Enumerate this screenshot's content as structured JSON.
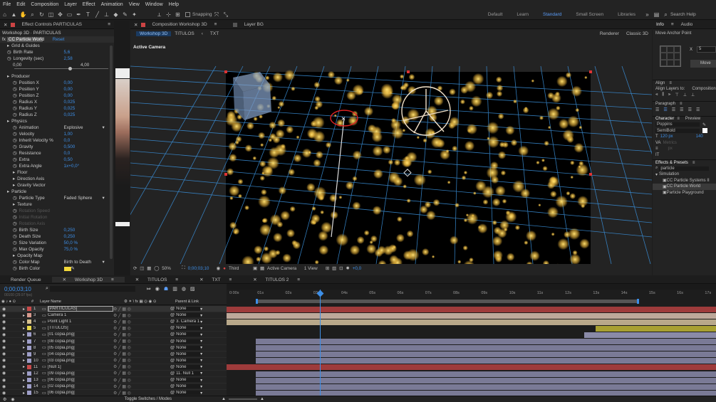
{
  "menu": [
    "File",
    "Edit",
    "Composition",
    "Layer",
    "Effect",
    "Animation",
    "View",
    "Window",
    "Help"
  ],
  "toolbar": {
    "snapping": "Snapping",
    "search": "Search Help",
    "workspaces": [
      "Default",
      "Learn",
      "Standard",
      "Small Screen",
      "Libraries"
    ]
  },
  "effects": {
    "tab": "Effect Controls",
    "tab_target": "PARTICULAS",
    "breadcrumb": "Workshop 3D · PARTICULAS",
    "effect_name": "CC Particle World",
    "reset": "Reset",
    "rows": [
      {
        "label": "Grid & Guides",
        "value": "",
        "indent": 1,
        "kind": "group"
      },
      {
        "label": "Birth Rate",
        "value": "5,6",
        "indent": 1,
        "kind": "param"
      },
      {
        "label": "Longevity (sec)",
        "value": "2,58",
        "indent": 1,
        "kind": "param"
      },
      {
        "label": "0,00",
        "value": "4,00",
        "indent": 2,
        "kind": "range"
      },
      {
        "label": "",
        "value": "",
        "indent": 0,
        "kind": "blank"
      },
      {
        "label": "Producer",
        "value": "",
        "indent": 1,
        "kind": "group"
      },
      {
        "label": "Position X",
        "value": "0,00",
        "indent": 2,
        "kind": "param"
      },
      {
        "label": "Position Y",
        "value": "0,00",
        "indent": 2,
        "kind": "param"
      },
      {
        "label": "Position Z",
        "value": "0,00",
        "indent": 2,
        "kind": "param"
      },
      {
        "label": "Radius X",
        "value": "0,025",
        "indent": 2,
        "kind": "param"
      },
      {
        "label": "Radius Y",
        "value": "0,025",
        "indent": 2,
        "kind": "param"
      },
      {
        "label": "Radius Z",
        "value": "0,025",
        "indent": 2,
        "kind": "param"
      },
      {
        "label": "Physics",
        "value": "",
        "indent": 1,
        "kind": "group"
      },
      {
        "label": "Animation",
        "value": "Explosive",
        "indent": 2,
        "kind": "select"
      },
      {
        "label": "Velocity",
        "value": "1,00",
        "indent": 2,
        "kind": "param"
      },
      {
        "label": "Inherit Velocity %",
        "value": "0,0",
        "indent": 2,
        "kind": "param"
      },
      {
        "label": "Gravity",
        "value": "0,500",
        "indent": 2,
        "kind": "param"
      },
      {
        "label": "Resistance",
        "value": "0,0",
        "indent": 2,
        "kind": "param"
      },
      {
        "label": "Extra",
        "value": "0,50",
        "indent": 2,
        "kind": "param"
      },
      {
        "label": "Extra Angle",
        "value": "1x+0,0°",
        "indent": 2,
        "kind": "param"
      },
      {
        "label": "Floor",
        "value": "",
        "indent": 2,
        "kind": "group"
      },
      {
        "label": "Direction Axis",
        "value": "",
        "indent": 2,
        "kind": "group"
      },
      {
        "label": "Gravity Vector",
        "value": "",
        "indent": 2,
        "kind": "group"
      },
      {
        "label": "Particle",
        "value": "",
        "indent": 1,
        "kind": "group"
      },
      {
        "label": "Particle Type",
        "value": "Faded Sphere",
        "indent": 2,
        "kind": "select"
      },
      {
        "label": "Texture",
        "value": "",
        "indent": 2,
        "kind": "group"
      },
      {
        "label": "Rotation Speed",
        "value": "",
        "indent": 2,
        "kind": "disabled"
      },
      {
        "label": "Initial Rotation",
        "value": "",
        "indent": 2,
        "kind": "disabled"
      },
      {
        "label": "Rotation Axis",
        "value": "",
        "indent": 2,
        "kind": "disabled"
      },
      {
        "label": "Birth Size",
        "value": "0,250",
        "indent": 2,
        "kind": "param"
      },
      {
        "label": "Death Size",
        "value": "0,250",
        "indent": 2,
        "kind": "param"
      },
      {
        "label": "Size Variation",
        "value": "50,0 %",
        "indent": 2,
        "kind": "param"
      },
      {
        "label": "Max Opacity",
        "value": "75,0 %",
        "indent": 2,
        "kind": "param"
      },
      {
        "label": "Opacity Map",
        "value": "",
        "indent": 2,
        "kind": "group"
      },
      {
        "label": "Color Map",
        "value": "Birth to Death",
        "indent": 2,
        "kind": "select"
      },
      {
        "label": "Birth Color",
        "value": "",
        "indent": 2,
        "kind": "color"
      }
    ]
  },
  "composition": {
    "tab": "Composition",
    "tab_target": "Workshop 3D",
    "layer_tab": "Layer BG",
    "subtabs": [
      "Workshop 3D",
      "TITULOS",
      "TXT"
    ],
    "renderer_label": "Renderer",
    "renderer_value": "Classic 3D",
    "camera_label": "Active Camera",
    "footer": {
      "zoom": "50%",
      "timecode": "0;00;03;10",
      "resolution": "Third",
      "camera": "Active Camera",
      "views": "1 View",
      "exposure": "+0,0"
    }
  },
  "right": {
    "info_tab": "Info",
    "audio_tab": "Audio",
    "anchor_title": "Move Anchor Point",
    "anchor_x_label": "X",
    "anchor_x": "5",
    "move_btn": "Move",
    "align_title": "Align",
    "align_to_label": "Align Layers to:",
    "align_to_value": "Composition",
    "paragraph_title": "Paragraph",
    "character_title": "Character",
    "preview_title": "Preview",
    "font": "Poppins",
    "font_style": "SemiBold",
    "font_size": "120 px",
    "tracking": "140",
    "metrics": "Metrics",
    "leading_unit": "px",
    "effects_title": "Effects & Presets",
    "search_value": "particle",
    "category": "Simulation",
    "presets": [
      "CC Particle Systems II",
      "CC Particle World",
      "Particle Playground"
    ]
  },
  "timeline": {
    "tabs": [
      "Render Queue",
      "Workshop 3D",
      "TITULOS",
      "TXT",
      "TITULOS 2"
    ],
    "timecode": "0;00;03;10",
    "frame_info": "00100 (29.97 fps)",
    "col_num": "#",
    "col_name": "Layer Name",
    "col_parent": "Parent & Link",
    "ruler": [
      "0:00s",
      "01s",
      "02s",
      "03s",
      "04s",
      "05s",
      "06s",
      "07s",
      "08s",
      "09s",
      "10s",
      "11s",
      "12s",
      "13s",
      "14s",
      "15s",
      "16s",
      "17s"
    ],
    "duration_s": 17.5,
    "playhead_s": 3.33,
    "toggle_label": "Toggle Switches / Modes",
    "layers": [
      {
        "num": "1",
        "name": "[PARTICULAS]",
        "color": "#c84a4a",
        "parent": "None",
        "start_s": 0,
        "end_s": 17.5,
        "bar": "#9e3b3b"
      },
      {
        "num": "3",
        "name": "Camera 1",
        "color": "#d79a8e",
        "parent": "None",
        "start_s": 0,
        "end_s": 17.5,
        "bar": "#bda89a"
      },
      {
        "num": "4",
        "name": "Point Light 1",
        "color": "#d7c08e",
        "parent": "3. Camera 1",
        "start_s": 0,
        "end_s": 17.5,
        "bar": "#b8a88a"
      },
      {
        "num": "5",
        "name": "[TITULOS]",
        "color": "#e8d84a",
        "parent": "None",
        "start_s": 13.2,
        "end_s": 17.5,
        "bar": "#a8a032"
      },
      {
        "num": "6",
        "name": "[01 copia.png]",
        "color": "#9e9ec8",
        "parent": "None",
        "start_s": 12.8,
        "end_s": 17.5,
        "bar": "#8a8aa8"
      },
      {
        "num": "7",
        "name": "[08 copia.png]",
        "color": "#9e9ec8",
        "parent": "None",
        "start_s": 1.05,
        "end_s": 17.5,
        "bar": "#7a7a96"
      },
      {
        "num": "8",
        "name": "[05 copia.png]",
        "color": "#9e9ec8",
        "parent": "None",
        "start_s": 1.05,
        "end_s": 17.5,
        "bar": "#7a7a96"
      },
      {
        "num": "9",
        "name": "[04 copia.png]",
        "color": "#9e9ec8",
        "parent": "None",
        "start_s": 1.05,
        "end_s": 17.5,
        "bar": "#7a7a96"
      },
      {
        "num": "10",
        "name": "[03 copia.png]",
        "color": "#9e9ec8",
        "parent": "None",
        "start_s": 1.05,
        "end_s": 17.5,
        "bar": "#7a7a96"
      },
      {
        "num": "11",
        "name": "[Null 1]",
        "color": "#c84a4a",
        "parent": "None",
        "start_s": 0,
        "end_s": 17.5,
        "bar": "#9e3b3b"
      },
      {
        "num": "12",
        "name": "[09 copia.png]",
        "color": "#9e9ec8",
        "parent": "11. Null 1",
        "start_s": 1.05,
        "end_s": 17.5,
        "bar": "#7a7a96"
      },
      {
        "num": "13",
        "name": "[06 copia.png]",
        "color": "#9e9ec8",
        "parent": "None",
        "start_s": 1.05,
        "end_s": 17.5,
        "bar": "#7a7a96"
      },
      {
        "num": "14",
        "name": "[02 copia.png]",
        "color": "#9e9ec8",
        "parent": "None",
        "start_s": 1.05,
        "end_s": 17.5,
        "bar": "#7a7a96"
      },
      {
        "num": "15",
        "name": "[06 copia.png]",
        "color": "#9e9ec8",
        "parent": "None",
        "start_s": 1.05,
        "end_s": 17.5,
        "bar": "#7a7a96"
      }
    ]
  },
  "colors": {
    "accent": "#3d8fe8",
    "particle": "#e8b43a",
    "grid": "#3a8fd8",
    "pink_bar": "#c94444"
  }
}
